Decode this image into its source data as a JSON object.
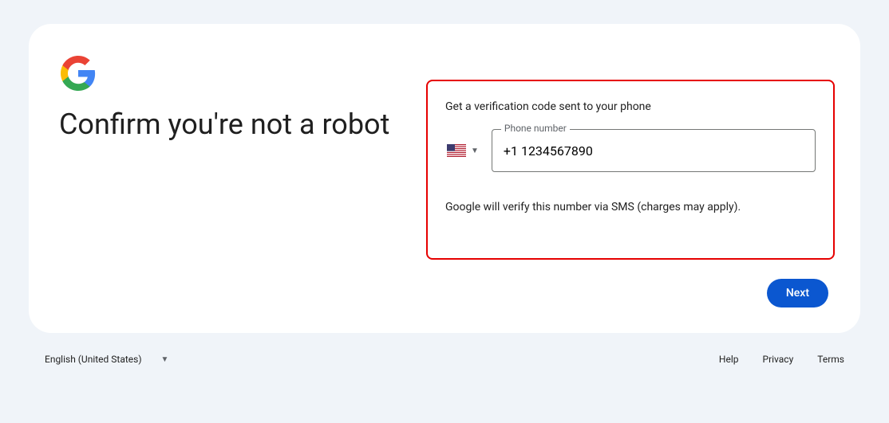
{
  "heading": "Confirm you're not a robot",
  "form": {
    "instruction": "Get a verification code sent to your phone",
    "phone_label": "Phone number",
    "phone_value": "+1 1234567890",
    "disclaimer": "Google will verify this number via SMS (charges may apply).",
    "next_label": "Next"
  },
  "footer": {
    "language": "English (United States)",
    "help": "Help",
    "privacy": "Privacy",
    "terms": "Terms"
  }
}
